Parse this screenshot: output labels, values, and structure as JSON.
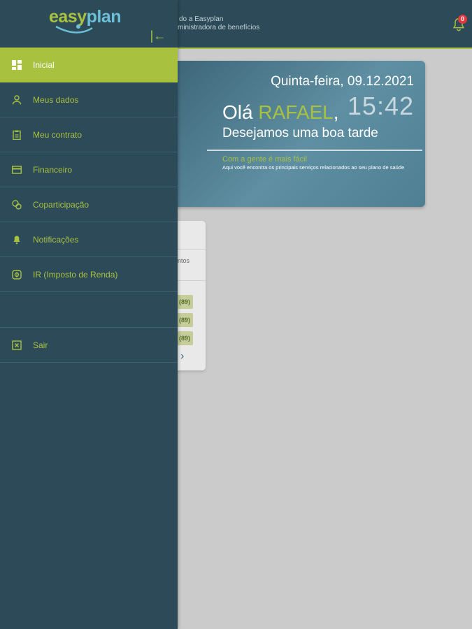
{
  "header": {
    "welcome_line1": "do a Easyplan",
    "welcome_line2": "ministradora de benefícios",
    "notification_count": "0"
  },
  "logo": {
    "easy": "easy",
    "plan": "plan"
  },
  "drawer": {
    "collapse_glyph": "|←",
    "items": [
      {
        "label": "Inicial",
        "icon": "dashboard-icon",
        "active": true
      },
      {
        "label": "Meus dados",
        "icon": "user-icon"
      },
      {
        "label": "Meu contrato",
        "icon": "contract-icon"
      },
      {
        "label": "Financeiro",
        "icon": "card-icon"
      },
      {
        "label": "Coparticipação",
        "icon": "coins-icon"
      },
      {
        "label": "Notificações",
        "icon": "bell-icon"
      },
      {
        "label": "IR (Imposto de Renda)",
        "icon": "tax-icon"
      },
      {
        "label": "Sair",
        "icon": "exit-icon"
      }
    ]
  },
  "greeting": {
    "date": "Quinta-feira, 09.12.2021",
    "time": "15:42",
    "hello_prefix": "Olá ",
    "name": "RAFAEL",
    "hello_suffix": ",",
    "wish": "Desejamos uma boa tarde",
    "slogan": "Com a gente é mais fácil",
    "slogan_sub": "Aqui você encontra os principais serviços relacionados ao seu plano de saúde"
  },
  "services_card": {
    "partial_text": "ntos",
    "chip_label": "(89)",
    "chevron": "›"
  },
  "colors": {
    "primary_dark": "#2d4a58",
    "accent_green": "#a8c240",
    "logo_blue": "#6bbfd6",
    "badge_red": "#e0393e"
  }
}
